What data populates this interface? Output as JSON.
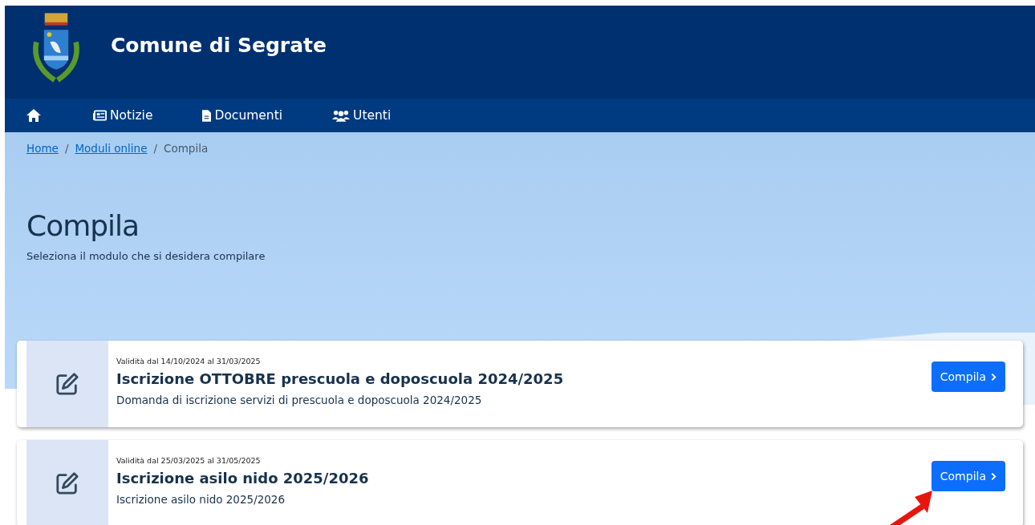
{
  "header": {
    "title": "Comune di Segrate"
  },
  "nav": [
    {
      "kind": "home"
    },
    {
      "kind": "news",
      "label": "Notizie"
    },
    {
      "kind": "document",
      "label": "Documenti"
    },
    {
      "kind": "users",
      "label": "Utenti"
    }
  ],
  "breadcrumb": [
    {
      "label": "Home",
      "link": true
    },
    {
      "label": "Moduli online",
      "link": true
    },
    {
      "label": "Compila",
      "link": false
    }
  ],
  "separator": "/",
  "page": {
    "title": "Compila",
    "subtitle": "Seleziona il modulo che si desidera compilare"
  },
  "forms": [
    {
      "validity": "Validità dal 14/10/2024 al 31/03/2025",
      "title": "Iscrizione OTTOBRE prescuola e doposcuola 2024/2025",
      "description": "Domanda di iscrizione servizi di prescuola e doposcuola 2024/2025",
      "button": "Compila"
    },
    {
      "validity": "Validità dal 25/03/2025 al 31/05/2025",
      "title": "Iscrizione asilo nido 2025/2026",
      "description": "Iscrizione asilo nido 2025/2026",
      "button": "Compila"
    }
  ]
}
